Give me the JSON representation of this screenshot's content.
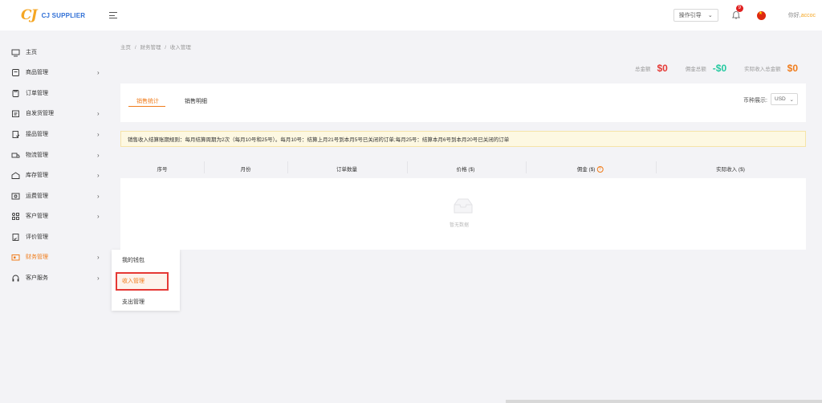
{
  "header": {
    "logo_mark": "CJ",
    "logo_text": "CJ SUPPLIER",
    "guide_select": "操作引导",
    "notification_count": "9",
    "greeting": "你好,",
    "username": "accoc"
  },
  "sidebar": {
    "items": [
      {
        "label": "主页",
        "icon": "monitor-icon",
        "arrow": false
      },
      {
        "label": "商品管理",
        "icon": "product-icon",
        "arrow": true
      },
      {
        "label": "订单管理",
        "icon": "order-icon",
        "arrow": false
      },
      {
        "label": "自发货管理",
        "icon": "clipboard-icon",
        "arrow": true
      },
      {
        "label": "接品管理",
        "icon": "clipboard-check-icon",
        "arrow": true
      },
      {
        "label": "物流管理",
        "icon": "truck-icon",
        "arrow": true
      },
      {
        "label": "库存管理",
        "icon": "warehouse-icon",
        "arrow": true
      },
      {
        "label": "运费管理",
        "icon": "image-icon",
        "arrow": true
      },
      {
        "label": "客户管理",
        "icon": "grid-icon",
        "arrow": true
      },
      {
        "label": "评价管理",
        "icon": "review-icon",
        "arrow": false
      },
      {
        "label": "财务管理",
        "icon": "finance-icon",
        "arrow": true,
        "active": true
      },
      {
        "label": "客户服务",
        "icon": "headset-icon",
        "arrow": true
      }
    ]
  },
  "submenu": {
    "items": [
      "我的钱包",
      "收入管理",
      "支出管理"
    ]
  },
  "breadcrumb": [
    "主页",
    "/",
    "财务管理",
    "/",
    "收入管理"
  ],
  "totals": {
    "total_label": "总金额",
    "total_value": "$0",
    "commission_label": "佣金总额",
    "commission_value": "-$0",
    "actual_label": "实际收入总金额",
    "actual_value": "$0"
  },
  "tabs": [
    "销售统计",
    "销售明细"
  ],
  "currency": {
    "label": "币种展示:",
    "value": "USD"
  },
  "notice": "销售收入结算账期规则：每月结算周期为2次（每月10号和25号）。每月10号：结算上月21号到本月5号已关闭的订单;每月25号：结算本月6号到本月20号已关闭的订单",
  "table": {
    "columns": [
      "序号",
      "月份",
      "订单数量",
      "价格 ($)",
      "佣金 ($)",
      "实际收入 ($)"
    ],
    "empty_text": "暂无数据"
  },
  "colors": {
    "accent": "#f07c1b",
    "red": "#e53935",
    "teal": "#24c9a0"
  }
}
